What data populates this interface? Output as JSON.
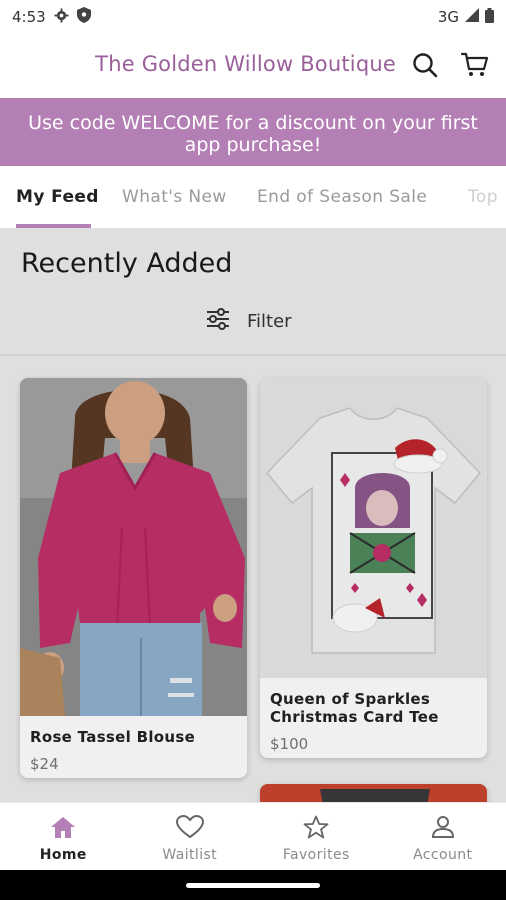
{
  "status_bar": {
    "time": "4:53",
    "network": "3G",
    "icons": [
      "gear-icon",
      "shield-icon",
      "signal-icon",
      "battery-icon"
    ]
  },
  "header": {
    "title": "The Golden Willow Boutique",
    "icons": [
      "search-icon",
      "cart-icon"
    ]
  },
  "banner": {
    "text": "Use code WELCOME for a discount on your first app purchase!"
  },
  "tabs": [
    {
      "label": "My Feed",
      "active": true
    },
    {
      "label": "What's New",
      "active": false
    },
    {
      "label": "End of Season Sale",
      "active": false
    },
    {
      "label": "Top",
      "active": false
    }
  ],
  "content": {
    "section_title": "Recently Added",
    "filter_label": "Filter"
  },
  "products": [
    {
      "name": "Rose Tassel Blouse",
      "price": "$24"
    },
    {
      "name": "Queen of Sparkles Christmas Card Tee",
      "price": "$100"
    }
  ],
  "bottom_nav": [
    {
      "label": "Home",
      "icon": "home-icon",
      "active": true
    },
    {
      "label": "Waitlist",
      "icon": "heart-icon",
      "active": false
    },
    {
      "label": "Favorites",
      "icon": "star-icon",
      "active": false
    },
    {
      "label": "Account",
      "icon": "person-icon",
      "active": false
    }
  ],
  "colors": {
    "brand": "#b47fb4",
    "brand_text": "#9a5f9a"
  }
}
